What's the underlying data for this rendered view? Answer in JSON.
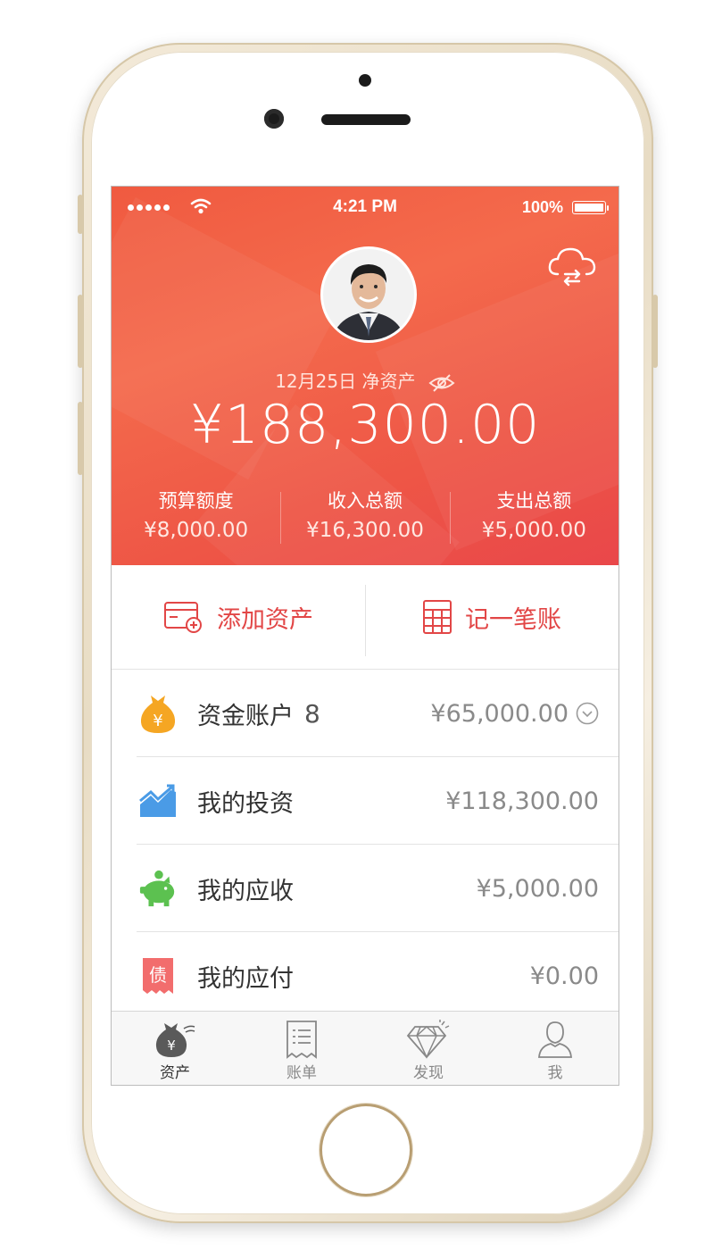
{
  "statusbar": {
    "time": "4:21 PM",
    "battery": "100%"
  },
  "header": {
    "date": "12月25日",
    "networth_label": "净资产",
    "networth_value": "¥188,300.00",
    "sync_icon": "cloud-sync-icon",
    "hide_icon": "eye-hidden-icon"
  },
  "stats": [
    {
      "label": "预算额度",
      "value": "¥8,000.00"
    },
    {
      "label": "收入总额",
      "value": "¥16,300.00"
    },
    {
      "label": "支出总额",
      "value": "¥5,000.00"
    }
  ],
  "actions": {
    "add_asset": "添加资产",
    "record": "记一笔账"
  },
  "accounts": [
    {
      "label": "资金账户",
      "count": "8",
      "amount": "¥65,000.00",
      "icon": "money-bag-icon"
    },
    {
      "label": "我的投资",
      "amount": "¥118,300.00",
      "icon": "trend-chart-icon"
    },
    {
      "label": "我的应收",
      "amount": "¥5,000.00",
      "icon": "piggy-bank-icon"
    },
    {
      "label": "我的应付",
      "amount": "¥0.00",
      "icon": "debt-icon",
      "debt_glyph": "债"
    }
  ],
  "tabs": [
    {
      "label": "资产",
      "icon": "asset-bag-icon"
    },
    {
      "label": "账单",
      "icon": "bill-icon"
    },
    {
      "label": "发现",
      "icon": "diamond-icon"
    },
    {
      "label": "我",
      "icon": "user-icon"
    }
  ],
  "colors": {
    "accent": "#e24646",
    "hero": "#f05a40"
  }
}
